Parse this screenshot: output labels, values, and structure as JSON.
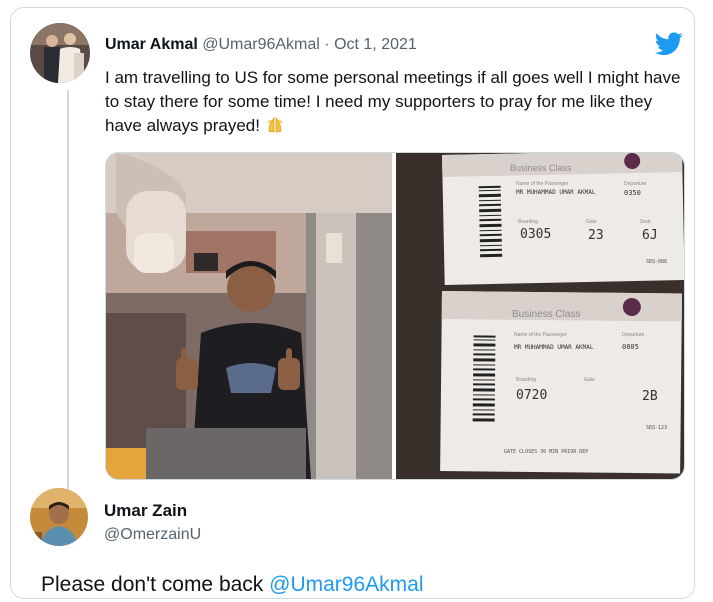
{
  "quoted_tweet": {
    "author_name": "Umar Akmal",
    "author_handle": "@Umar96Akmal",
    "separator": " · ",
    "date": "Oct 1, 2021",
    "text": "I am travelling to US for some personal meetings if all goes well I might have to stay there for some time! I need my supporters to pray for me like they have always prayed!",
    "emoji": "praying-hands-emoji",
    "brand_icon": "twitter-bird-icon",
    "brand_color": "#1d9bf0"
  },
  "media": {
    "boarding_pass_1": {
      "class_label": "Business Class",
      "passenger_label": "Name of the Passenger",
      "passenger_name": "MR MUHAMMAD UMAR AKMAL",
      "departure_label": "Departure",
      "departure_time": "0350",
      "boarding_label": "Boarding",
      "boarding_time": "0305",
      "gate_label": "Gate",
      "gate": "23",
      "seat_label": "Seat",
      "seat": "6J",
      "seq": "SEQ-088"
    },
    "boarding_pass_2": {
      "class_label": "Business Class",
      "passenger_label": "Name of the Passenger",
      "passenger_name": "MR MUHAMMAD UMAR AKMAL",
      "departure_label": "Departure",
      "departure_time": "0805",
      "boarding_label": "Boarding",
      "boarding_time": "0720",
      "gate_label": "Gate",
      "seat": "2B",
      "seq": "SEQ-123",
      "gate_closes": "GATE CLOSES 30 MIN PRIOR DEP"
    }
  },
  "reply": {
    "author_name": "Umar Zain",
    "author_handle": "@OmerzainU",
    "text": "Please don't come back ",
    "mention": "@Umar96Akmal"
  },
  "colors": {
    "text_primary": "#0f1419",
    "text_secondary": "#536471",
    "link": "#1d9bf0",
    "border": "#cfd9de"
  }
}
